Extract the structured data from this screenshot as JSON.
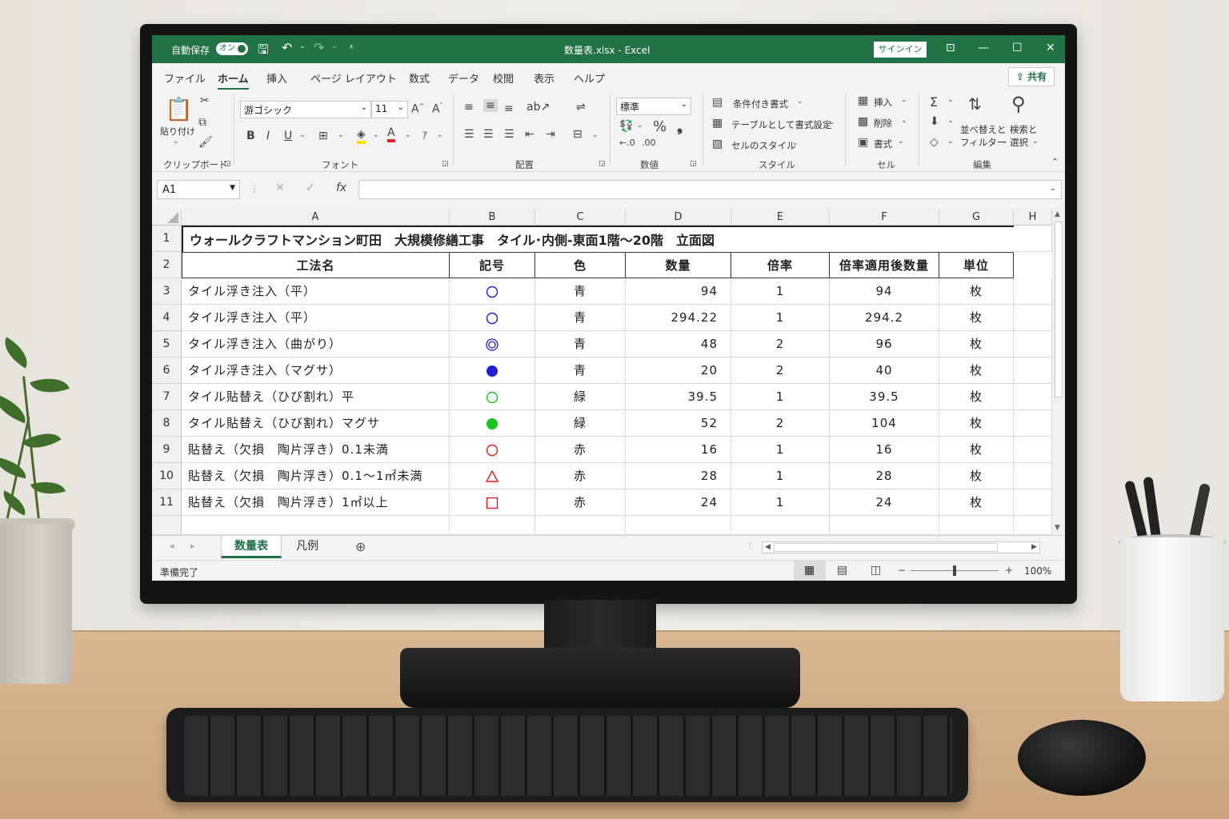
{
  "titlebar": {
    "autosave_label": "自動保存",
    "autosave_state": "オン",
    "filename": "数量表.xlsx - Excel",
    "signin_label": "サインイン"
  },
  "menu": {
    "items": [
      "ファイル",
      "ホーム",
      "挿入",
      "ページ レイアウト",
      "数式",
      "データ",
      "校閲",
      "表示",
      "ヘルプ"
    ],
    "active": "ホーム",
    "share_label": "共有"
  },
  "ribbon": {
    "clipboard": {
      "paste_label": "貼り付け",
      "group_label": "クリップボード"
    },
    "font": {
      "name": "游ゴシック",
      "size": "11",
      "group_label": "フォント"
    },
    "alignment": {
      "group_label": "配置"
    },
    "number": {
      "format": "標準",
      "group_label": "数値"
    },
    "styles": {
      "conditional": "条件付き書式",
      "table": "テーブルとして書式設定",
      "cell_styles": "セルのスタイル",
      "group_label": "スタイル"
    },
    "cells": {
      "insert": "挿入",
      "delete": "削除",
      "format": "書式",
      "group_label": "セル"
    },
    "editing": {
      "sort_filter_1": "並べ替えと",
      "sort_filter_2": "フィルター",
      "find_select_1": "検索と",
      "find_select_2": "選択",
      "group_label": "編集"
    }
  },
  "formula_bar": {
    "name_box": "A1",
    "formula": ""
  },
  "columns": [
    "A",
    "B",
    "C",
    "D",
    "E",
    "F",
    "G",
    "H"
  ],
  "rows": [
    "1",
    "2",
    "3",
    "4",
    "5",
    "6",
    "7",
    "8",
    "9",
    "10",
    "11"
  ],
  "sheet": {
    "title": "ウォールクラフトマンション町田　大規模修繕工事　タイル･内側-東面1階～20階　立面図",
    "headers": [
      "工法名",
      "記号",
      "色",
      "数量",
      "倍率",
      "倍率適用後数量",
      "単位"
    ],
    "data": [
      {
        "method": "タイル浮き注入（平）",
        "symbol": "circle-outline",
        "color": "青",
        "qty": "94",
        "rate": "1",
        "adj_qty": "94",
        "unit": "枚"
      },
      {
        "method": "タイル浮き注入（平）",
        "symbol": "circle-outline",
        "color": "青",
        "qty": "294.22",
        "rate": "1",
        "adj_qty": "294.2",
        "unit": "枚"
      },
      {
        "method": "タイル浮き注入（曲がり）",
        "symbol": "double-circle",
        "color": "青",
        "qty": "48",
        "rate": "2",
        "adj_qty": "96",
        "unit": "枚"
      },
      {
        "method": "タイル浮き注入（マグサ）",
        "symbol": "filled-circle",
        "color": "青",
        "qty": "20",
        "rate": "2",
        "adj_qty": "40",
        "unit": "枚"
      },
      {
        "method": "タイル貼替え（ひび割れ）平",
        "symbol": "circle-outline",
        "color": "緑",
        "qty": "39.5",
        "rate": "1",
        "adj_qty": "39.5",
        "unit": "枚"
      },
      {
        "method": "タイル貼替え（ひび割れ）マグサ",
        "symbol": "filled-circle",
        "color": "緑",
        "qty": "52",
        "rate": "2",
        "adj_qty": "104",
        "unit": "枚"
      },
      {
        "method": "貼替え（欠損　陶片浮き）0.1未満",
        "symbol": "circle-outline",
        "color": "赤",
        "qty": "16",
        "rate": "1",
        "adj_qty": "16",
        "unit": "枚"
      },
      {
        "method": "貼替え（欠損　陶片浮き）0.1～1㎡未満",
        "symbol": "triangle-outline",
        "color": "赤",
        "qty": "28",
        "rate": "1",
        "adj_qty": "28",
        "unit": "枚"
      },
      {
        "method": "貼替え（欠損　陶片浮き）1㎡以上",
        "symbol": "square-outline",
        "color": "赤",
        "qty": "24",
        "rate": "1",
        "adj_qty": "24",
        "unit": "枚"
      }
    ]
  },
  "symbol_colors": {
    "青": "#1f1fd6",
    "緑": "#1bc41b",
    "赤": "#e02020"
  },
  "sheet_tabs": [
    "数量表",
    "凡例"
  ],
  "active_tab": "数量表",
  "status": {
    "ready": "準備完了",
    "zoom": "100%"
  },
  "accent": "#217346"
}
